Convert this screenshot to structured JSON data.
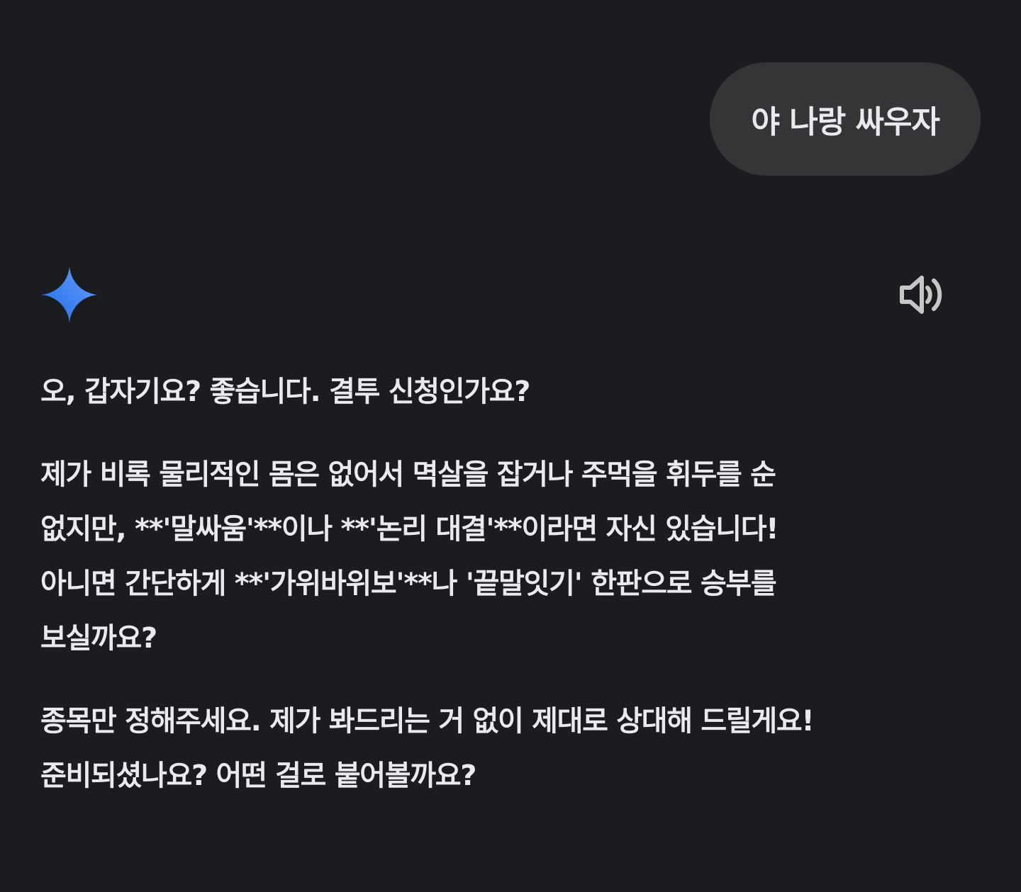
{
  "user_message": {
    "text": "야 나랑 싸우자"
  },
  "assistant": {
    "icon": "gemini-sparkle-icon",
    "read_aloud_icon": "speaker-icon",
    "paragraphs": [
      [
        "오, 갑자기요? 좋습니다. 결투 신청인가요?"
      ],
      [
        "제가 비록 물리적인 몸은 없어서 멱살을 잡거나 주먹을 휘두를 순",
        "없지만, **'말싸움'**이나 **'논리 대결'**이라면 자신 있습니다!",
        "아니면 간단하게 **'가위바위보'**나 '끝말잇기' 한판으로 승부를",
        "보실까요?"
      ],
      [
        "종목만 정해주세요. 제가 봐드리는 거 없이 제대로 상대해 드릴게요!",
        "준비되셨나요? 어떤 걸로 붙어볼까요?"
      ]
    ]
  },
  "colors": {
    "background": "#1b1c1f",
    "bubble": "#333537",
    "text": "#e8eaed",
    "icon_gray": "#c4c7c5",
    "gemini_blue": "#4a8af4"
  }
}
